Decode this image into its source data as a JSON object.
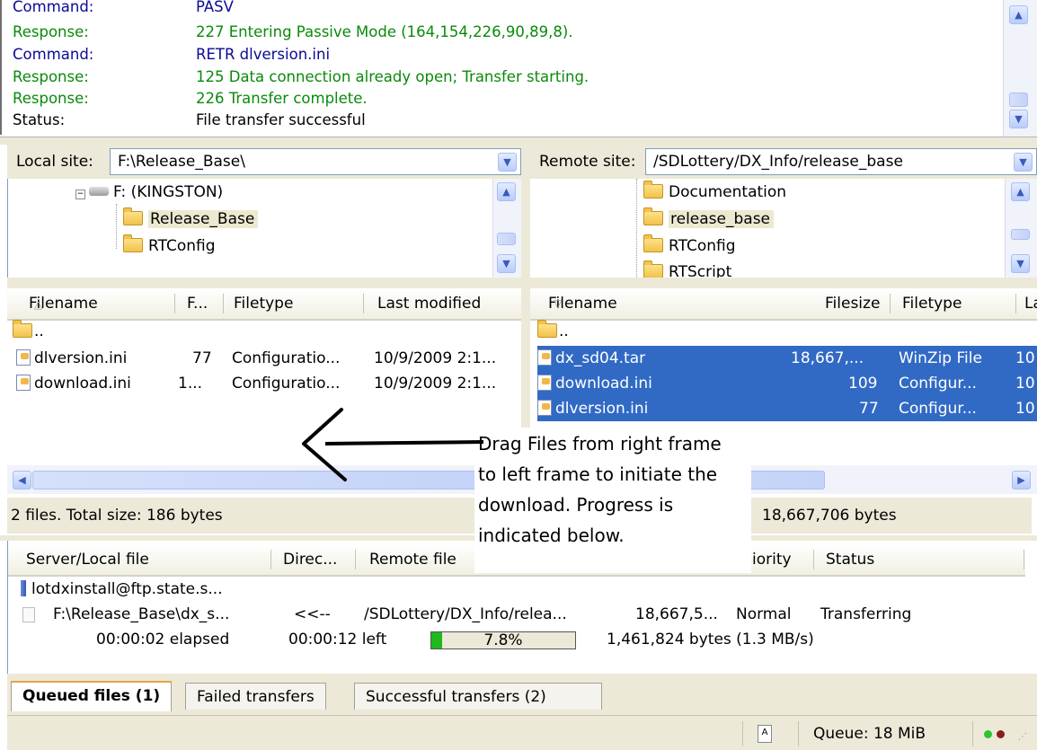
{
  "log": {
    "rows": [
      {
        "kind": "Command:",
        "text": "PASV",
        "type": "cmd"
      },
      {
        "kind": "Response:",
        "text": "227 Entering Passive Mode (164,154,226,90,89,8).",
        "type": "resp"
      },
      {
        "kind": "Command:",
        "text": "RETR dlversion.ini",
        "type": "cmd"
      },
      {
        "kind": "Response:",
        "text": "125 Data connection already open; Transfer starting.",
        "type": "resp"
      },
      {
        "kind": "Response:",
        "text": "226 Transfer complete.",
        "type": "resp"
      },
      {
        "kind": "Status:",
        "text": "File transfer successful",
        "type": "stat"
      }
    ]
  },
  "local": {
    "label": "Local site:",
    "path": "F:\\Release_Base\\",
    "tree": {
      "drive": "F: (KINGSTON)",
      "folders": [
        "Release_Base",
        "RTConfig"
      ]
    },
    "columns": {
      "filename": "Filename",
      "filesize": "F...",
      "filetype": "Filetype",
      "modified": "Last modified"
    },
    "files": [
      {
        "name": "..",
        "size": "",
        "type": "",
        "modified": ""
      },
      {
        "name": "dlversion.ini",
        "size": "77",
        "type": "Configuratio...",
        "modified": "10/9/2009 2:1..."
      },
      {
        "name": "download.ini",
        "size": "1...",
        "type": "Configuratio...",
        "modified": "10/9/2009 2:1..."
      }
    ],
    "status": "2 files. Total size: 186 bytes"
  },
  "remote": {
    "label": "Remote site:",
    "path": "/SDLottery/DX_Info/release_base",
    "tree": [
      "Documentation",
      "release_base",
      "RTConfig",
      "RTScript"
    ],
    "columns": {
      "filename": "Filename",
      "filesize": "Filesize",
      "filetype": "Filetype",
      "modified": "La"
    },
    "files": [
      {
        "name": "..",
        "size": "",
        "type": "",
        "modified": ""
      },
      {
        "name": "dx_sd04.tar",
        "size": "18,667,...",
        "type": "WinZip File",
        "modified": "10"
      },
      {
        "name": "download.ini",
        "size": "109",
        "type": "Configur...",
        "modified": "10"
      },
      {
        "name": "dlversion.ini",
        "size": "77",
        "type": "Configur...",
        "modified": "10"
      }
    ],
    "status": "18,667,706 bytes"
  },
  "callout": {
    "lines": [
      "Drag Files from right frame",
      "to left frame to initiate the",
      "download. Progress is",
      "indicated below."
    ]
  },
  "queue": {
    "columns": {
      "server": "Server/Local file",
      "direction": "Direc...",
      "remote": "Remote file",
      "priority": "iority",
      "status": "Status"
    },
    "server": "lotdxinstall@ftp.state.s...",
    "item": {
      "local": "F:\\Release_Base\\dx_s...",
      "direction": "<<--",
      "remote": "/SDLottery/DX_Info/relea...",
      "size": "18,667,5...",
      "priority": "Normal",
      "status": "Transferring"
    },
    "progress": {
      "elapsed": "00:00:02 elapsed",
      "left": "00:00:12 left",
      "percent_text": "7.8%",
      "fraction": 0.078,
      "bytes": "1,461,824 bytes (1.3 MB/s)"
    },
    "tabs": [
      "Queued files (1)",
      "Failed transfers",
      "Successful transfers (2)"
    ]
  },
  "statusbar": {
    "queue": "Queue: 18 MiB"
  },
  "colors": {
    "selection": "#316ac5",
    "command": "#0a0a95",
    "response": "#0a8a0a",
    "progress": "#1fb81f"
  }
}
